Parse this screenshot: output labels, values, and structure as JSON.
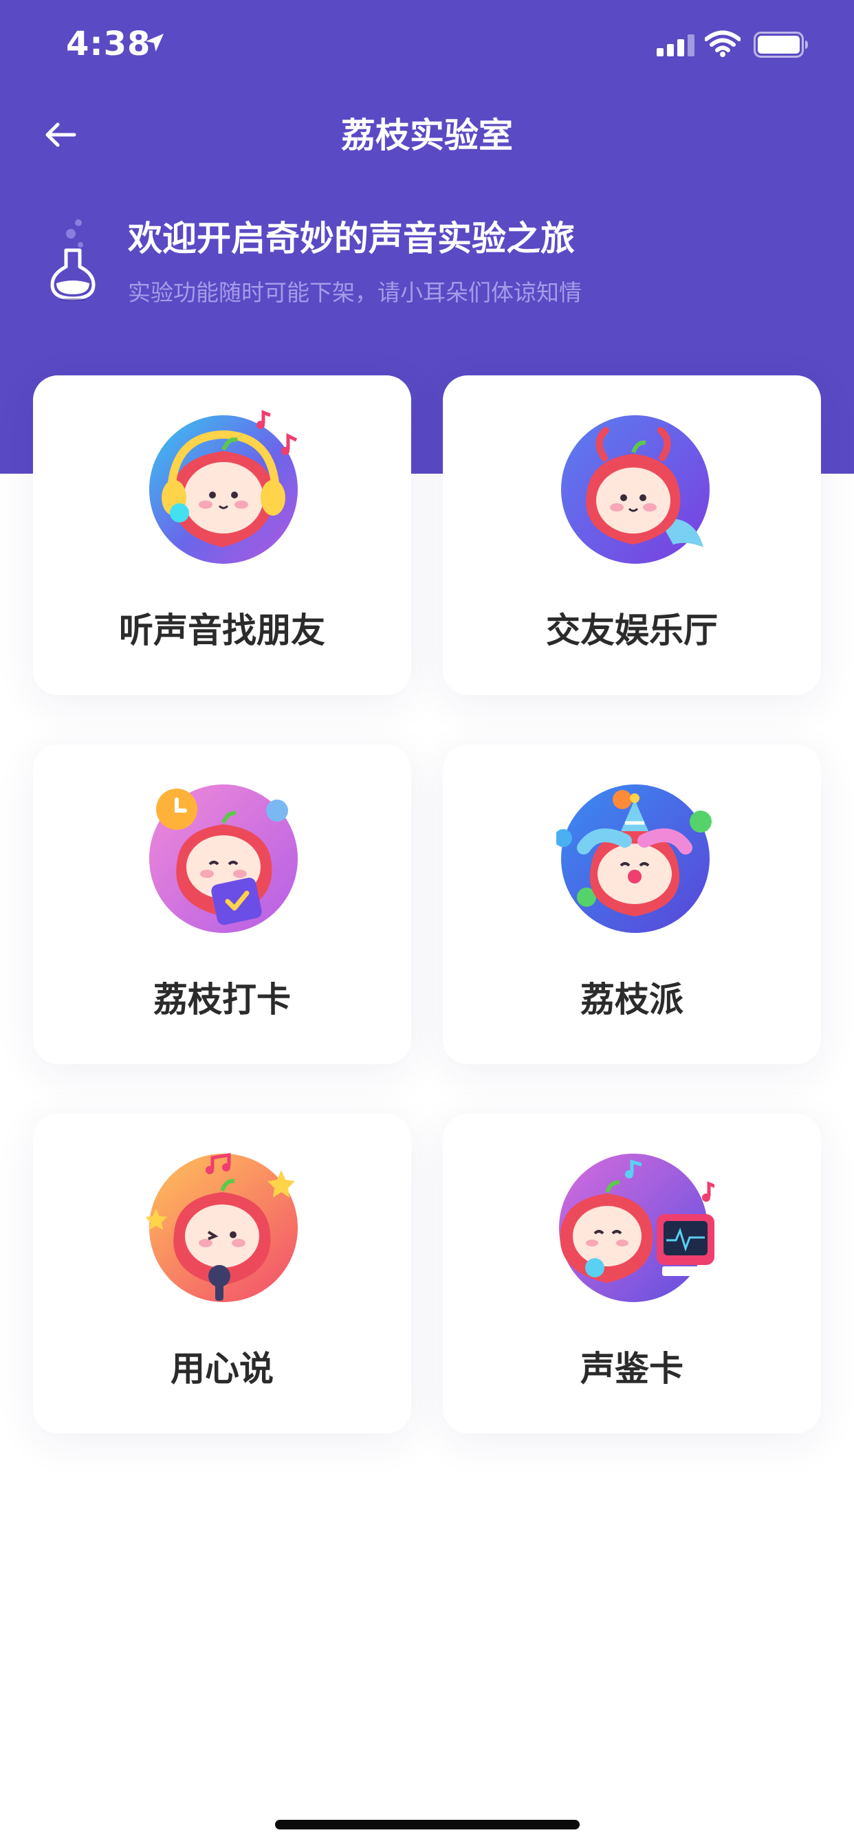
{
  "status_bar": {
    "time": "4:38",
    "location_icon": "location-arrow-icon",
    "signal_icon": "cellular-signal-icon",
    "wifi_icon": "wifi-icon",
    "battery_icon": "battery-icon"
  },
  "nav": {
    "title": "荔枝实验室",
    "back_icon": "back-arrow-icon"
  },
  "welcome": {
    "icon": "flask-icon",
    "title": "欢迎开启奇妙的声音实验之旅",
    "subtitle": "实验功能随时可能下架，请小耳朵们体谅知情"
  },
  "features": [
    {
      "label": "听声音找朋友",
      "icon": "headphones-mascot-icon"
    },
    {
      "label": "交友娱乐厅",
      "icon": "capricorn-mascot-icon"
    },
    {
      "label": "荔枝打卡",
      "icon": "checkin-mascot-icon"
    },
    {
      "label": "荔枝派",
      "icon": "party-mascot-icon"
    },
    {
      "label": "用心说",
      "icon": "microphone-mascot-icon"
    },
    {
      "label": "声鉴卡",
      "icon": "voice-monitor-mascot-icon"
    }
  ],
  "colors": {
    "header_background": "#5a4ac4",
    "page_background": "#ffffff",
    "card_background": "#ffffff",
    "title_text": "#ffffff",
    "subtitle_text": "#a69bea",
    "card_label_text": "#2b2b2b"
  }
}
